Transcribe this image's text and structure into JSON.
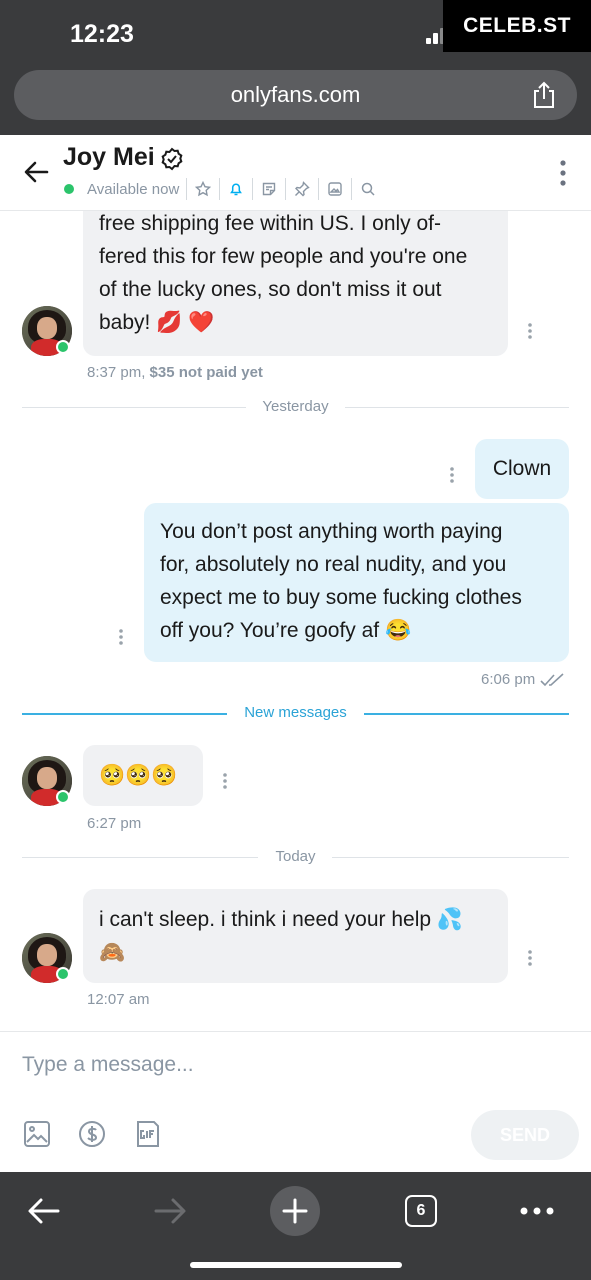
{
  "status_bar": {
    "time": "12:23",
    "watermark": "CELEB.ST"
  },
  "browser": {
    "url": "onlyfans.com",
    "tab_count": "6"
  },
  "chat_header": {
    "name": "Joy Mei",
    "status": "Available now",
    "icons": [
      "star-icon",
      "bell-icon",
      "sticker-icon",
      "pin-icon",
      "image-icon",
      "search-icon"
    ]
  },
  "messages": [
    {
      "direction": "in",
      "lines": [
        "free shipping fee within US. I only of-",
        "fered this for few people and you're one",
        "of the lucky ones, so don't miss it out",
        "baby! 💋 ❤️"
      ],
      "time": "8:37 pm,",
      "price_note": "$35 not paid yet"
    },
    {
      "type": "divider",
      "label": "Yesterday"
    },
    {
      "direction": "out",
      "text": "Clown"
    },
    {
      "direction": "out",
      "lines": [
        "You don’t post anything worth paying",
        "for, absolutely no real nudity, and you",
        "expect me to buy some fucking clothes",
        "off you? You’re goofy af 😂"
      ],
      "time": "6:06 pm"
    },
    {
      "type": "divider",
      "label": "New messages"
    },
    {
      "direction": "in",
      "text": "🥺🥺🥺",
      "time": "6:27 pm"
    },
    {
      "type": "divider",
      "label": "Today"
    },
    {
      "direction": "in",
      "lines": [
        "i can't sleep. i think i need your help 💦",
        "🙈"
      ],
      "time": "12:07 am"
    }
  ],
  "composer": {
    "placeholder": "Type a message...",
    "send_label": "SEND"
  },
  "colors": {
    "accent": "#00aff0",
    "online": "#2bc46b",
    "incoming_bg": "#f0f1f3",
    "outgoing_bg": "#e2f3fb"
  }
}
